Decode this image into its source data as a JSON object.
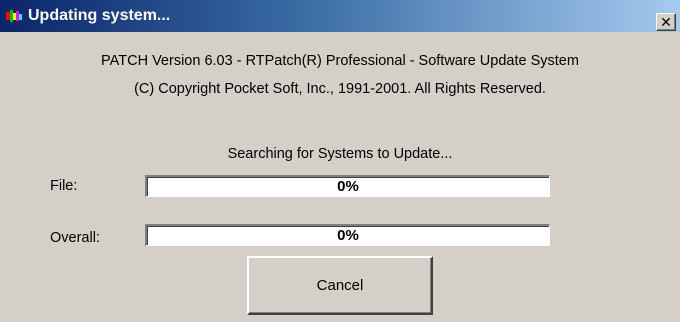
{
  "window": {
    "title": "Updating system...",
    "close_glyph": "✕",
    "icon": "rtpatch-app-icon"
  },
  "info": {
    "version_line": "PATCH  Version 6.03 - RTPatch(R) Professional - Software Update System",
    "copyright_line": "(C) Copyright Pocket Soft, Inc., 1991-2001.  All Rights Reserved.",
    "status": "Searching for Systems to Update..."
  },
  "progress": {
    "file": {
      "label": "File:",
      "percent_text": "0%",
      "fraction": 0
    },
    "overall": {
      "label": "Overall:",
      "percent_text": "0%",
      "fraction": 0
    }
  },
  "buttons": {
    "cancel_label": "Cancel"
  },
  "colors": {
    "titlebar_start": "#0a246a",
    "titlebar_end": "#a6caf0",
    "dialog_face": "#d4d0c8",
    "progress_fill": "#0a246a"
  }
}
